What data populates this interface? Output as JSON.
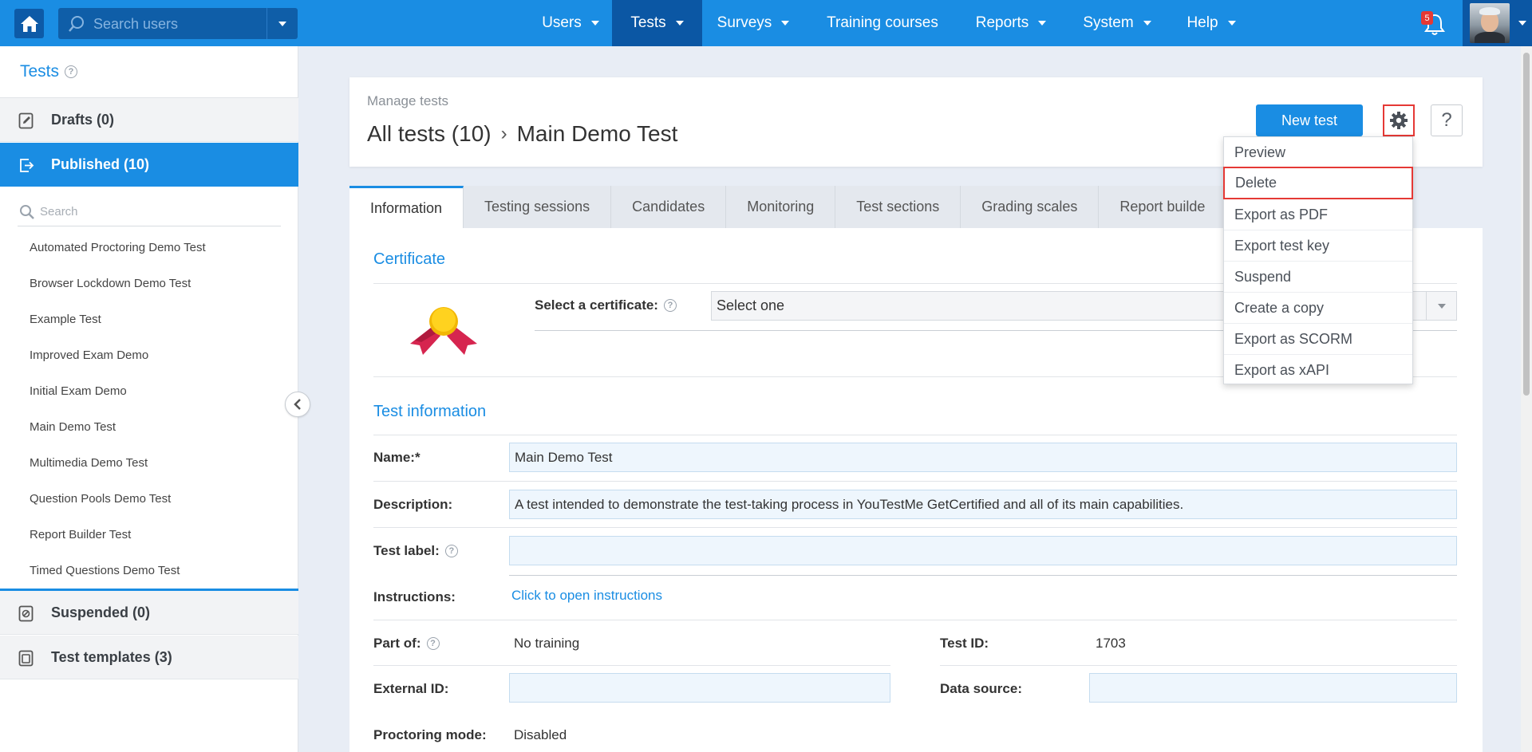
{
  "topbar": {
    "search_placeholder": "Search users",
    "nav": [
      {
        "label": "Users",
        "has_caret": true,
        "active": false
      },
      {
        "label": "Tests",
        "has_caret": true,
        "active": true
      },
      {
        "label": "Surveys",
        "has_caret": true,
        "active": false
      },
      {
        "label": "Training courses",
        "has_caret": false,
        "active": false
      },
      {
        "label": "Reports",
        "has_caret": true,
        "active": false
      },
      {
        "label": "System",
        "has_caret": true,
        "active": false
      },
      {
        "label": "Help",
        "has_caret": true,
        "active": false
      }
    ],
    "notification_count": "5",
    "colors": {
      "bar": "#1a8de3",
      "active": "#0b57a4"
    }
  },
  "sidebar": {
    "title": "Tests",
    "sections": {
      "drafts": "Drafts (0)",
      "published": "Published (10)",
      "suspended": "Suspended (0)",
      "templates": "Test templates (3)"
    },
    "search_placeholder": "Search",
    "tests": [
      "Automated Proctoring Demo Test",
      "Browser Lockdown Demo Test",
      "Example Test",
      "Improved Exam Demo",
      "Initial Exam Demo",
      "Main Demo Test",
      "Multimedia Demo Test",
      "Question Pools Demo Test",
      "Report Builder Test",
      "Timed Questions Demo Test"
    ]
  },
  "header": {
    "subtitle": "Manage tests",
    "breadcrumb_root": "All tests (10)",
    "breadcrumb_sep": "›",
    "breadcrumb_current": "Main Demo Test",
    "new_test_label": "New test",
    "help_label": "?"
  },
  "tabs": [
    {
      "label": "Information",
      "active": true
    },
    {
      "label": "Testing sessions",
      "active": false
    },
    {
      "label": "Candidates",
      "active": false
    },
    {
      "label": "Monitoring",
      "active": false
    },
    {
      "label": "Test sections",
      "active": false
    },
    {
      "label": "Grading scales",
      "active": false
    },
    {
      "label": "Report builde",
      "active": false
    }
  ],
  "certificate": {
    "section_title": "Certificate",
    "select_label": "Select a certificate:",
    "select_value": "Select one"
  },
  "test_info": {
    "section_title": "Test information",
    "name_label": "Name:*",
    "name_value": "Main Demo Test",
    "description_label": "Description:",
    "description_value": "A test intended to demonstrate the test-taking process in YouTestMe GetCertified and all of its main capabilities.",
    "test_label_label": "Test label:",
    "test_label_value": "",
    "instructions_label": "Instructions:",
    "instructions_link": "Click to open instructions",
    "part_of_label": "Part of:",
    "part_of_value": "No training",
    "test_id_label": "Test ID:",
    "test_id_value": "1703",
    "external_id_label": "External ID:",
    "external_id_value": "",
    "data_source_label": "Data source:",
    "data_source_value": "",
    "proctoring_label": "Proctoring mode:",
    "proctoring_value": "Disabled"
  },
  "settings_menu": {
    "items": [
      "Preview",
      "Delete",
      "Export as PDF",
      "Export test key",
      "Suspend",
      "Create a copy",
      "Export as SCORM",
      "Export as xAPI"
    ],
    "highlighted": "Delete"
  }
}
